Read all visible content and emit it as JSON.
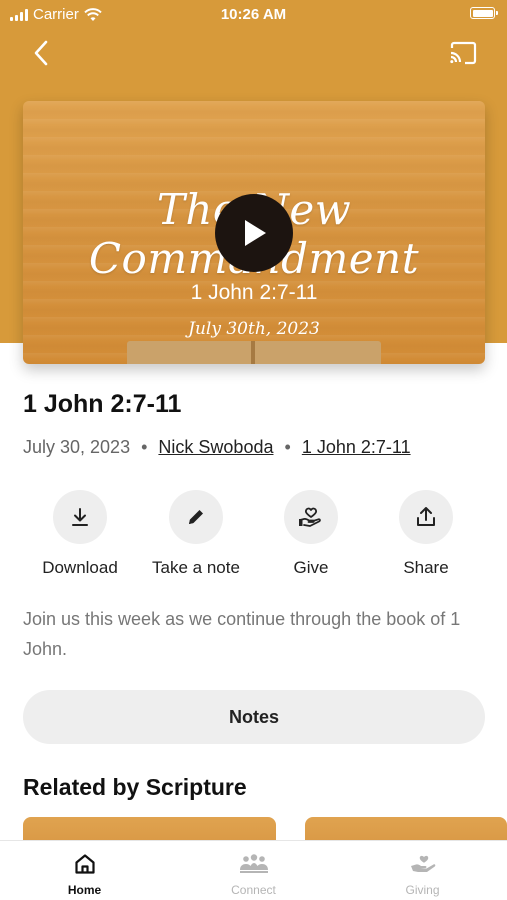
{
  "status_bar": {
    "carrier": "Carrier",
    "time": "10:26 AM"
  },
  "video": {
    "title_overlay": "The New Commandment",
    "reference_overlay": "1 John 2:7-11",
    "date_overlay": "July 30th, 2023"
  },
  "sermon": {
    "title": "1 John 2:7-11",
    "date": "July 30, 2023",
    "separator": "•",
    "speaker": "Nick Swoboda",
    "scripture": "1 John 2:7-11"
  },
  "actions": [
    {
      "label": "Download",
      "icon": "download-icon"
    },
    {
      "label": "Take a note",
      "icon": "pencil-icon"
    },
    {
      "label": "Give",
      "icon": "give-hand-heart-icon"
    },
    {
      "label": "Share",
      "icon": "share-icon"
    }
  ],
  "description": "Join us this week as we continue through the book of 1 John.",
  "notes_label": "Notes",
  "related_heading": "Related by Scripture",
  "tabs": [
    {
      "label": "Home",
      "icon": "home-icon",
      "active": true
    },
    {
      "label": "Connect",
      "icon": "people-icon",
      "active": false
    },
    {
      "label": "Giving",
      "icon": "hand-heart-icon",
      "active": false
    }
  ],
  "colors": {
    "brand": "#d79a3a",
    "active_tab": "#111111",
    "inactive_tab": "#b5b5b5",
    "chip_bg": "#eeeeee"
  }
}
